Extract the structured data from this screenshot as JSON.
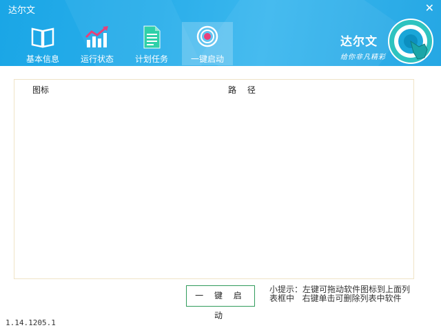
{
  "window": {
    "title": "达尔文",
    "close_icon": "close-icon"
  },
  "tabs": [
    {
      "label": "基本信息",
      "icon": "book-icon"
    },
    {
      "label": "运行状态",
      "icon": "chart-icon"
    },
    {
      "label": "计划任务",
      "icon": "document-icon"
    },
    {
      "label": "一键启动",
      "icon": "power-target-icon",
      "active": true
    }
  ],
  "brand": {
    "name": "达尔文",
    "slogan": "给你非凡精彩",
    "logo_icon": "finger-touch-logo"
  },
  "list": {
    "columns": {
      "icon": "图标",
      "path": "路 径"
    },
    "rows": []
  },
  "actions": {
    "launch_label": "一 键 启 动"
  },
  "hint": {
    "line1": "小提示：左键可拖动软件图标到上面列",
    "line2": "表框中   右键单击可删除列表中软件"
  },
  "version": "1.14.1205.1",
  "colors": {
    "header": "#22a9e6",
    "button_border": "#2e9a5a",
    "list_border": "#efe3c6",
    "accent": "#e8407a"
  }
}
